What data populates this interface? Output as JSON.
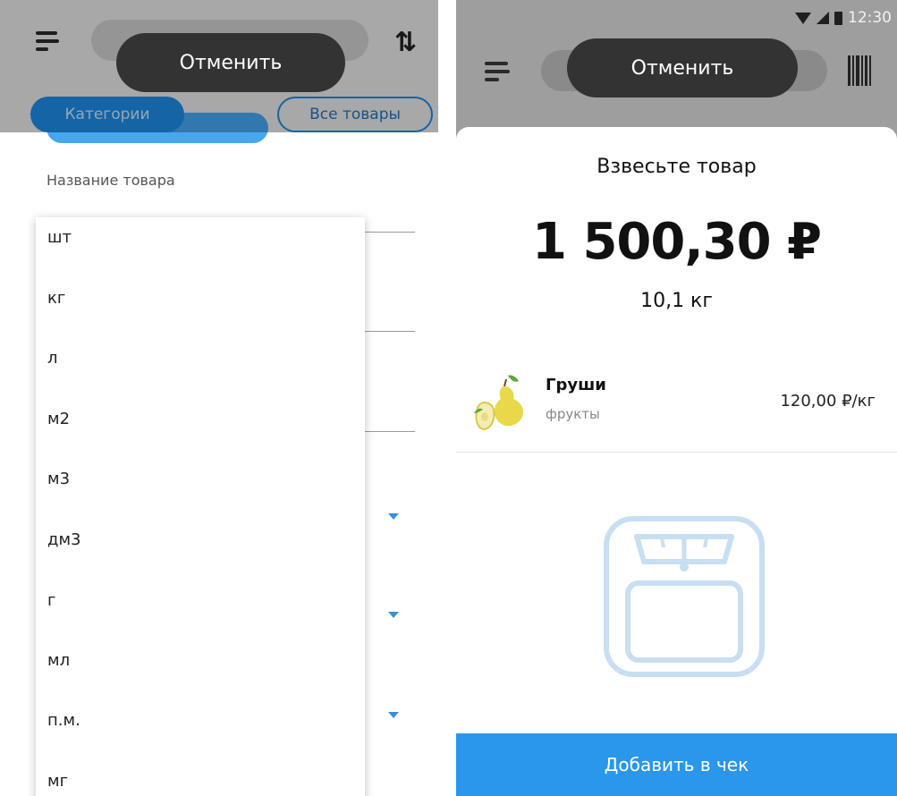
{
  "left": {
    "toast_label": "Отменить",
    "tabs": {
      "categories": "Категории",
      "all_products": "Все товары"
    },
    "sort_icon": "sort-arrows-icon",
    "menu_icon": "hamburger-icon",
    "form": {
      "name_label": "Название товара"
    },
    "units": [
      "шт",
      "кг",
      "л",
      "м2",
      "м3",
      "дм3",
      "г",
      "мл",
      "п.м.",
      "мг"
    ]
  },
  "right": {
    "status_time": "12:30",
    "toast_label": "Отменить",
    "barcode_icon": "barcode-icon",
    "sheet": {
      "title": "Взвесьте товар",
      "total": "1 500,30 ₽",
      "weight": "10,1 кг"
    },
    "product": {
      "name": "Груши",
      "category": "фрукты",
      "price": "120,00 ₽/кг"
    },
    "add_button": "Добавить в чек"
  },
  "colors": {
    "accent": "#2a97ec",
    "toast": "#333333",
    "scale_icon": "#c8def2"
  }
}
